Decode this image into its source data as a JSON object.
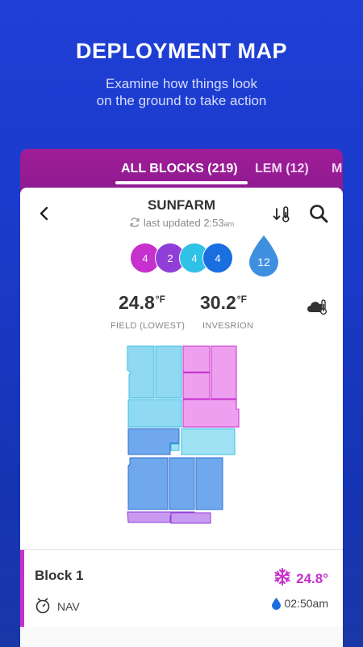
{
  "hero": {
    "title": "DEPLOYMENT MAP",
    "subtitle_line1": "Examine how things look",
    "subtitle_line2": "on the ground to take action"
  },
  "tabs": [
    {
      "label": "ALL BLOCKS (219)",
      "active": true
    },
    {
      "label": "LEM (12)",
      "active": false
    },
    {
      "label": "M",
      "active": false
    }
  ],
  "header": {
    "farm_name": "SUNFARM",
    "updated_prefix": "last updated",
    "updated_time": "2:53",
    "updated_ampm": "am",
    "back_icon": "chevron-left-icon",
    "sort_icon": "sort-temperature-icon",
    "search_icon": "search-icon"
  },
  "counts": [
    {
      "value": "4",
      "color": "#c630cc"
    },
    {
      "value": "2",
      "color": "#8f3fd8"
    },
    {
      "value": "4",
      "color": "#2fc1e6"
    },
    {
      "value": "4",
      "color": "#1a6fe0"
    }
  ],
  "water_drop": {
    "value": "12",
    "color": "#3f8fe0"
  },
  "stats": [
    {
      "value": "24.8",
      "unit": "°F",
      "label": "FIELD (LOWEST)"
    },
    {
      "value": "30.2",
      "unit": "°F",
      "label": "INVESRION"
    }
  ],
  "weather_icon": "cloud-thermometer-icon",
  "map_colors": {
    "light_blue": "#8fd9f2",
    "pink": "#ef9ff0",
    "blue": "#6fa8ec",
    "purple": "#c89af0",
    "cyan": "#9fe2f4"
  },
  "block": {
    "name": "Block 1",
    "temp": "24.8°",
    "status": "NAV",
    "time": "02:50am",
    "accent": "#c630cc"
  }
}
